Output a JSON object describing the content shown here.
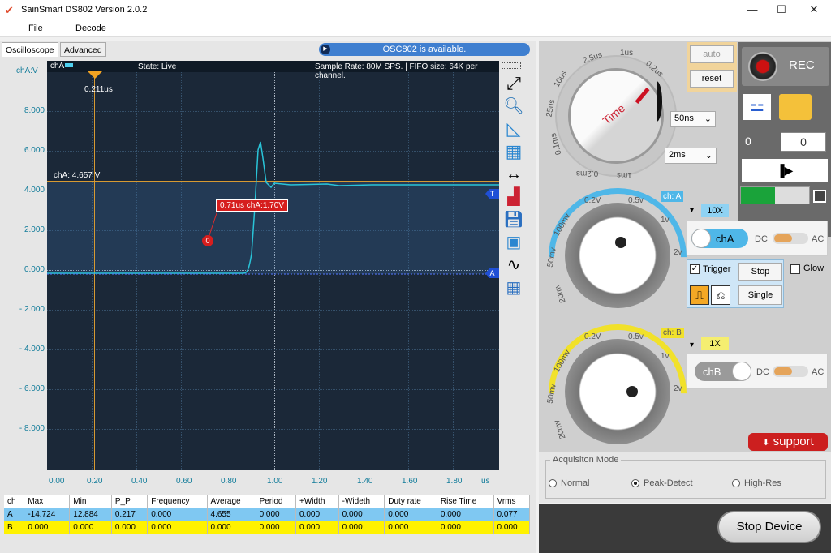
{
  "window": {
    "title": "SainSmart DS802  Version 2.0.2"
  },
  "menu": {
    "file": "File",
    "decode": "Decode"
  },
  "tabs": [
    "Oscilloscope",
    "Advanced"
  ],
  "notice": "OSC802  is available.",
  "plot": {
    "channel_label": "chA",
    "y_unit_label": "chA:V",
    "state": "State: Live",
    "sample_info": "Sample Rate: 80M SPS. | FIFO size: 64K per channel.",
    "cursor_time": "0.211us",
    "level_text": "chA: 4.657 V",
    "marker_text": "0.71us chA:1.70V",
    "marker_id": "0",
    "trigger_marker": "T",
    "channel_marker": "A",
    "y_ticks": [
      "8.000",
      "6.000",
      "4.000",
      "2.000",
      "0.000",
      "- 2.000",
      "- 4.000",
      "- 6.000",
      "- 8.000"
    ],
    "x_ticks": [
      "0.00",
      "0.20",
      "0.40",
      "0.60",
      "0.80",
      "1.00",
      "1.20",
      "1.40",
      "1.60",
      "1.80"
    ],
    "x_unit": "us"
  },
  "time_knob": {
    "label": "Time",
    "ticks": [
      "1us",
      "2.5us",
      "10us",
      "25us",
      "0.1ms",
      "0.2ms",
      "1ms",
      "0.2us"
    ],
    "sel1": "50ns",
    "sel2": "2ms"
  },
  "controls": {
    "auto": "auto",
    "reset": "reset",
    "rec": "REC",
    "count1": "0",
    "count2": "0"
  },
  "chA": {
    "tag": "ch: A",
    "probe": "10X",
    "button": "chA",
    "dc": "DC",
    "ac": "AC",
    "ticks": [
      "0.2V",
      "0.5v",
      "1v",
      "2v",
      "100mv",
      "50mv",
      "20mv"
    ],
    "color": "#4fb7e8"
  },
  "chB": {
    "tag": "ch: B",
    "probe": "1X",
    "button": "chB",
    "dc": "DC",
    "ac": "AC",
    "ticks": [
      "0.2V",
      "0.5v",
      "1v",
      "2v",
      "100mv",
      "50mv",
      "20mv"
    ],
    "color": "#f1e12a"
  },
  "trigger": {
    "label": "Trigger",
    "stop": "Stop",
    "single": "Single",
    "glow": "Glow"
  },
  "support": "support",
  "acquisition": {
    "title": "Acquisiton Mode",
    "options": [
      "Normal",
      "Peak-Detect",
      "High-Res"
    ],
    "selected": "Peak-Detect"
  },
  "stop_device": "Stop Device",
  "table": {
    "headers": [
      "ch",
      "Max",
      "Min",
      "P_P",
      "Frequency",
      "Average",
      "Period",
      "+Width",
      "-Wideth",
      "Duty rate",
      "Rise Time",
      "Vrms"
    ],
    "rows": [
      [
        "A",
        "-14.724",
        "12.884",
        "0.217",
        "0.000",
        "4.655",
        "0.000",
        "0.000",
        "0.000",
        "0.000",
        "0.000",
        "0.077"
      ],
      [
        "B",
        "0.000",
        "0.000",
        "0.000",
        "0.000",
        "0.000",
        "0.000",
        "0.000",
        "0.000",
        "0.000",
        "0.000",
        "0.000"
      ]
    ]
  }
}
